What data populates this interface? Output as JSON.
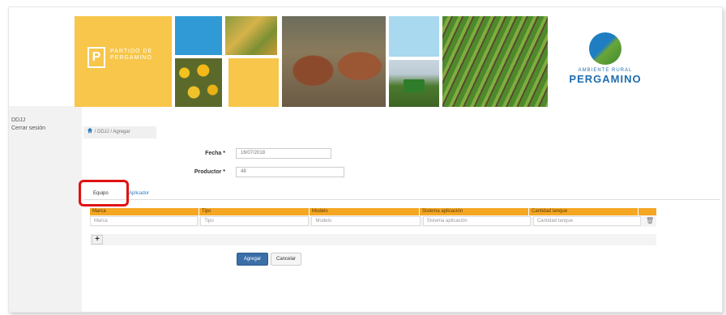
{
  "sidebar": {
    "items": [
      {
        "label": "DDJJ"
      },
      {
        "label": "Cerrar sesión"
      }
    ]
  },
  "banner": {
    "municipality_line1": "PARTIDO DE",
    "municipality_line2": "PERGAMINO",
    "municipality_letter": "P",
    "brand_small": "AMBIENTE RURAL",
    "brand_big": "PERGAMINO"
  },
  "breadcrumb": {
    "items": [
      "DDJJ",
      "Agregar"
    ],
    "separator": "/"
  },
  "form": {
    "fecha_label": "Fecha *",
    "fecha_value": "16/07/2018",
    "productor_label": "Productor *",
    "productor_value": "48"
  },
  "tabs": [
    {
      "label": "Equipo",
      "active": true
    },
    {
      "label": "Aplicador",
      "active": false
    }
  ],
  "grid": {
    "columns": [
      "Marca",
      "Tipo",
      "Modelo",
      "Sistema aplicación",
      "Cantidad tanque"
    ],
    "placeholders": [
      "Marca",
      "Tipo",
      "Modelo",
      "Sistema aplicación",
      "Cantidad tanque"
    ],
    "add_label": "+"
  },
  "buttons": {
    "primary": "Agregar",
    "secondary": "Cancelar"
  },
  "colors": {
    "grid_header": "#f5a623",
    "primary_button": "#3b6fa8",
    "highlight": "#e01212",
    "link": "#2f7ac0"
  }
}
